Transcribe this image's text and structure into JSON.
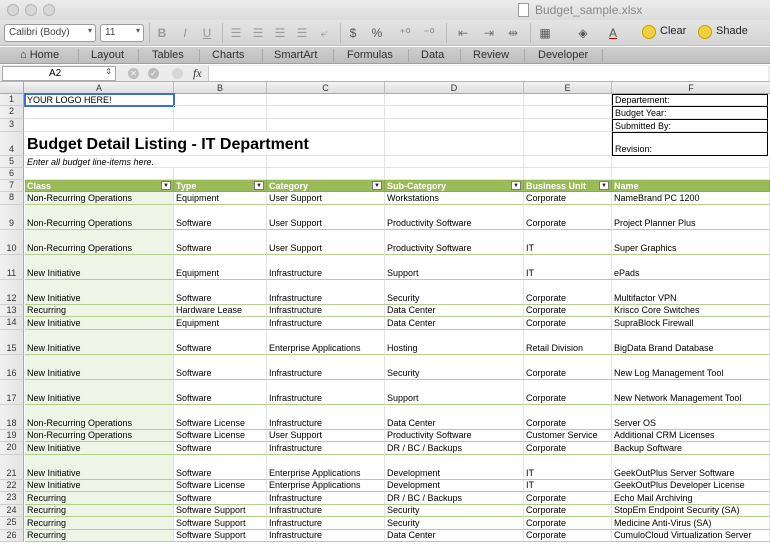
{
  "window": {
    "title": "Budget_sample.xlsx"
  },
  "toolbar": {
    "font_name": "Calibri (Body)",
    "font_size": "11",
    "bold": "B",
    "italic": "I",
    "underline": "U",
    "currency": "$",
    "percent": "%",
    "clear_label": "Clear",
    "shade_label": "Shade"
  },
  "ribbon": {
    "tabs": [
      "Home",
      "Layout",
      "Tables",
      "Charts",
      "SmartArt",
      "Formulas",
      "Data",
      "Review",
      "Developer"
    ]
  },
  "formula_bar": {
    "cell_ref": "A2",
    "fx": "fx",
    "value": ""
  },
  "columns": [
    "A",
    "B",
    "C",
    "D",
    "E",
    "F"
  ],
  "sheet": {
    "logo_text": "YOUR LOGO HERE!",
    "title": "Budget Detail Listing - IT Department",
    "subtitle": "Enter all budget line-items here.",
    "info_labels": [
      "Departement:",
      "Budget Year:",
      "Submitted By:",
      "Revision:"
    ],
    "headers": [
      "Class",
      "Type",
      "Category",
      "Sub-Category",
      "Business Unit",
      "Name"
    ],
    "rows": [
      {
        "n": "8",
        "cells": [
          "Non-Recurring Operations",
          "Equipment",
          "User Support",
          "Workstations",
          "Corporate",
          "NameBrand PC 1200"
        ]
      },
      {
        "n": "9",
        "cells": [
          "Non-Recurring Operations",
          "Software",
          "User Support",
          "Productivity Software",
          "Corporate",
          "Project Planner Plus"
        ]
      },
      {
        "n": "10",
        "cells": [
          "Non-Recurring Operations",
          "Software",
          "User Support",
          "Productivity Software",
          "IT",
          "Super Graphics"
        ]
      },
      {
        "n": "11",
        "cells": [
          "New Initiative",
          "Equipment",
          "Infrastructure",
          "Support",
          "IT",
          "ePads"
        ]
      },
      {
        "n": "12",
        "cells": [
          "New Initiative",
          "Software",
          "Infrastructure",
          "Security",
          "Corporate",
          "Multifactor VPN"
        ]
      },
      {
        "n": "13",
        "cells": [
          "Recurring",
          "Hardware Lease",
          "Infrastructure",
          "Data Center",
          "Corporate",
          "Krisco Core Switches"
        ]
      },
      {
        "n": "14",
        "cells": [
          "New Initiative",
          "Equipment",
          "Infrastructure",
          "Data Center",
          "Corporate",
          "SupraBlock Firewall"
        ]
      },
      {
        "n": "15",
        "cells": [
          "New Initiative",
          "Software",
          "Enterprise Applications",
          "Hosting",
          "Retail Division",
          "BigData Brand Database"
        ]
      },
      {
        "n": "16",
        "cells": [
          "New Initiative",
          "Software",
          "Infrastructure",
          "Security",
          "Corporate",
          "New Log Management Tool"
        ]
      },
      {
        "n": "17",
        "cells": [
          "New Initiative",
          "Software",
          "Infrastructure",
          "Support",
          "Corporate",
          "New Network Management Tool"
        ]
      },
      {
        "n": "18",
        "cells": [
          "Non-Recurring Operations",
          "Software License",
          "Infrastructure",
          "Data Center",
          "Corporate",
          "Server OS"
        ]
      },
      {
        "n": "19",
        "cells": [
          "Non-Recurring Operations",
          "Software License",
          "User Support",
          "Productivity Software",
          "Customer Service",
          "Additional CRM Licenses"
        ]
      },
      {
        "n": "20",
        "cells": [
          "New Initiative",
          "Software",
          "Infrastructure",
          "DR / BC / Backups",
          "Corporate",
          "Backup Software"
        ]
      },
      {
        "n": "21",
        "cells": [
          "New Initiative",
          "Software",
          "Enterprise Applications",
          "Development",
          "IT",
          "GeekOutPlus Server Software"
        ]
      },
      {
        "n": "22",
        "cells": [
          "New Initiative",
          "Software License",
          "Enterprise Applications",
          "Development",
          "IT",
          "GeekOutPlus Developer License"
        ]
      },
      {
        "n": "23",
        "cells": [
          "Recurring",
          "Software",
          "Infrastructure",
          "DR / BC / Backups",
          "Corporate",
          "Echo Mail Archiving"
        ]
      },
      {
        "n": "24",
        "cells": [
          "Recurring",
          "Software Support",
          "Infrastructure",
          "Security",
          "Corporate",
          "StopEm Endpoint Security (SA)"
        ]
      },
      {
        "n": "25",
        "cells": [
          "Recurring",
          "Software Support",
          "Infrastructure",
          "Security",
          "Corporate",
          "Medicine Anti-Virus (SA)"
        ]
      },
      {
        "n": "26",
        "cells": [
          "Recurring",
          "Software Support",
          "Infrastructure",
          "Data Center",
          "Corporate",
          "CumuloCloud Virtualization Server"
        ]
      }
    ],
    "row_numbers_top": [
      "1",
      "2",
      "3",
      "4",
      "5",
      "6",
      "7"
    ]
  },
  "colors": {
    "header_green": "#9bbb59",
    "band_green": "#eef4e6",
    "rule_green": "#b5d08c"
  }
}
